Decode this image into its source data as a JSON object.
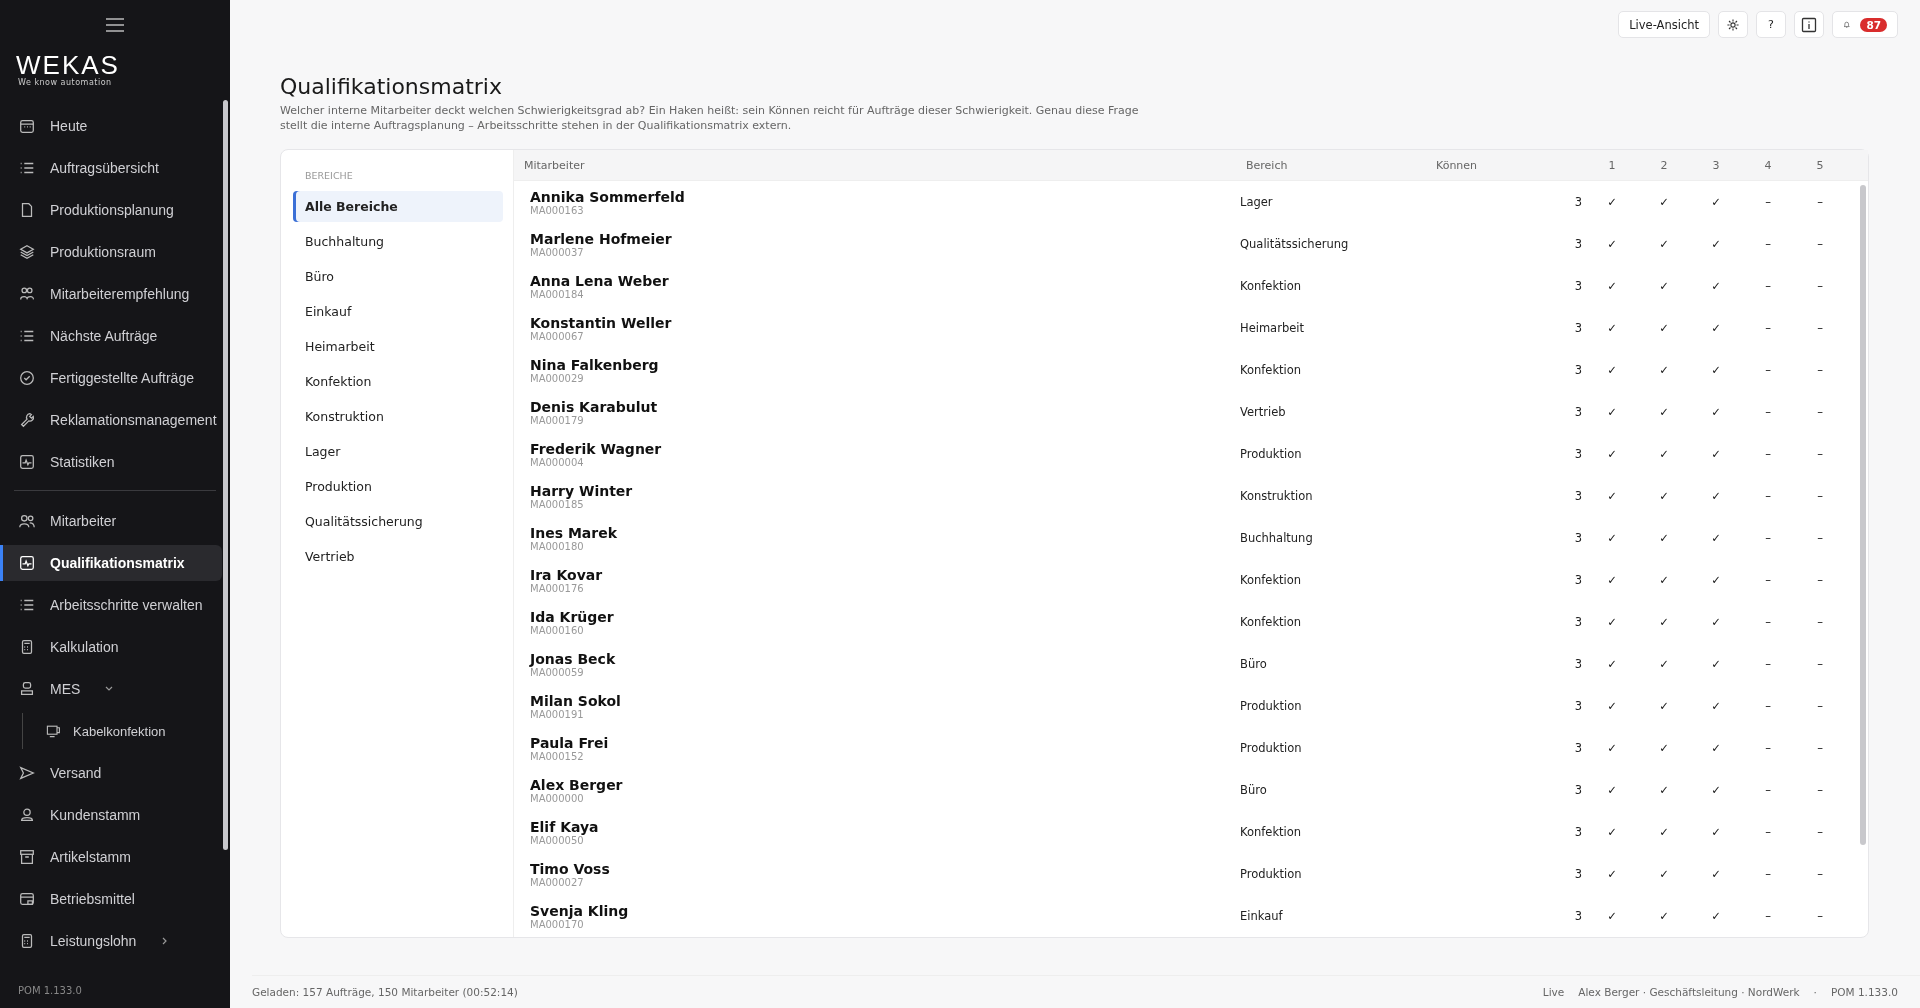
{
  "sidebar": {
    "logo": "WEKAS",
    "tagline": "We know automation",
    "items": [
      {
        "label": "Heute",
        "selected": false
      },
      {
        "label": "Auftragsübersicht",
        "selected": false
      },
      {
        "label": "Produktionsplanung",
        "selected": false
      },
      {
        "label": "Produktionsraum",
        "selected": false
      },
      {
        "label": "Mitarbeiterempfehlung",
        "selected": false
      },
      {
        "label": "Nächste Aufträge",
        "selected": false
      },
      {
        "label": "Fertiggestellte Aufträge",
        "selected": false
      },
      {
        "label": "Reklamationsmanagement",
        "selected": false
      },
      {
        "label": "Statistiken",
        "selected": false,
        "divider_after": true
      },
      {
        "label": "Mitarbeiter",
        "selected": false
      },
      {
        "label": "Qualifikationsmatrix",
        "selected": true
      },
      {
        "label": "Arbeitsschritte verwalten",
        "selected": false
      },
      {
        "label": "Kalkulation",
        "selected": false
      },
      {
        "label": "MES",
        "selected": false,
        "expanded": true,
        "children": [
          {
            "label": "Kabelkonfektion",
            "selected": false
          }
        ]
      },
      {
        "label": "Versand",
        "selected": false
      },
      {
        "label": "Kundenstamm",
        "selected": false
      },
      {
        "label": "Artikelstamm",
        "selected": false
      },
      {
        "label": "Betriebsmittel",
        "selected": false
      },
      {
        "label": "Leistungslohn",
        "selected": false,
        "expanded": false
      }
    ],
    "version": "POM 1.133.0"
  },
  "toolbar": {
    "live_button": "Live-Ansicht",
    "help_button": "?",
    "notification_count": "87"
  },
  "page": {
    "title": "Qualifikationsmatrix",
    "description": "Welcher interne Mitarbeiter deckt welchen Schwierigkeitsgrad ab? Ein Haken heißt: sein Können reicht für Aufträge dieser Schwierigkeit. Genau diese Frage stellt die interne Auftragsplanung – Arbeitsschritte stehen in der Qualifikationsmatrix extern."
  },
  "filters": {
    "heading": "BEREICHE",
    "items": [
      {
        "label": "Alle Bereiche",
        "selected": true
      },
      {
        "label": "Buchhaltung",
        "selected": false
      },
      {
        "label": "Büro",
        "selected": false
      },
      {
        "label": "Einkauf",
        "selected": false
      },
      {
        "label": "Heimarbeit",
        "selected": false
      },
      {
        "label": "Konfektion",
        "selected": false
      },
      {
        "label": "Konstruktion",
        "selected": false
      },
      {
        "label": "Lager",
        "selected": false
      },
      {
        "label": "Produktion",
        "selected": false
      },
      {
        "label": "Qualitätssicherung",
        "selected": false
      },
      {
        "label": "Vertrieb",
        "selected": false
      }
    ]
  },
  "table": {
    "columns": [
      "Mitarbeiter",
      "Bereich",
      "Können",
      "1",
      "2",
      "3",
      "4",
      "5"
    ],
    "rows": [
      {
        "name": "Annika Sommerfeld",
        "id": "MA000163",
        "area": "Lager",
        "skill": "3",
        "levels": [
          "✓",
          "✓",
          "✓",
          "–",
          "–"
        ]
      },
      {
        "name": "Marlene Hofmeier",
        "id": "MA000037",
        "area": "Qualitätssicherung",
        "skill": "3",
        "levels": [
          "✓",
          "✓",
          "✓",
          "–",
          "–"
        ]
      },
      {
        "name": "Anna Lena Weber",
        "id": "MA000184",
        "area": "Konfektion",
        "skill": "3",
        "levels": [
          "✓",
          "✓",
          "✓",
          "–",
          "–"
        ]
      },
      {
        "name": "Konstantin Weller",
        "id": "MA000067",
        "area": "Heimarbeit",
        "skill": "3",
        "levels": [
          "✓",
          "✓",
          "✓",
          "–",
          "–"
        ]
      },
      {
        "name": "Nina Falkenberg",
        "id": "MA000029",
        "area": "Konfektion",
        "skill": "3",
        "levels": [
          "✓",
          "✓",
          "✓",
          "–",
          "–"
        ]
      },
      {
        "name": "Denis Karabulut",
        "id": "MA000179",
        "area": "Vertrieb",
        "skill": "3",
        "levels": [
          "✓",
          "✓",
          "✓",
          "–",
          "–"
        ]
      },
      {
        "name": "Frederik Wagner",
        "id": "MA000004",
        "area": "Produktion",
        "skill": "3",
        "levels": [
          "✓",
          "✓",
          "✓",
          "–",
          "–"
        ]
      },
      {
        "name": "Harry Winter",
        "id": "MA000185",
        "area": "Konstruktion",
        "skill": "3",
        "levels": [
          "✓",
          "✓",
          "✓",
          "–",
          "–"
        ]
      },
      {
        "name": "Ines Marek",
        "id": "MA000180",
        "area": "Buchhaltung",
        "skill": "3",
        "levels": [
          "✓",
          "✓",
          "✓",
          "–",
          "–"
        ]
      },
      {
        "name": "Ira Kovar",
        "id": "MA000176",
        "area": "Konfektion",
        "skill": "3",
        "levels": [
          "✓",
          "✓",
          "✓",
          "–",
          "–"
        ]
      },
      {
        "name": "Ida Krüger",
        "id": "MA000160",
        "area": "Konfektion",
        "skill": "3",
        "levels": [
          "✓",
          "✓",
          "✓",
          "–",
          "–"
        ]
      },
      {
        "name": "Jonas Beck",
        "id": "MA000059",
        "area": "Büro",
        "skill": "3",
        "levels": [
          "✓",
          "✓",
          "✓",
          "–",
          "–"
        ]
      },
      {
        "name": "Milan Sokol",
        "id": "MA000191",
        "area": "Produktion",
        "skill": "3",
        "levels": [
          "✓",
          "✓",
          "✓",
          "–",
          "–"
        ]
      },
      {
        "name": "Paula Frei",
        "id": "MA000152",
        "area": "Produktion",
        "skill": "3",
        "levels": [
          "✓",
          "✓",
          "✓",
          "–",
          "–"
        ]
      },
      {
        "name": "Alex Berger",
        "id": "MA000000",
        "area": "Büro",
        "skill": "3",
        "levels": [
          "✓",
          "✓",
          "✓",
          "–",
          "–"
        ]
      },
      {
        "name": "Elif Kaya",
        "id": "MA000050",
        "area": "Konfektion",
        "skill": "3",
        "levels": [
          "✓",
          "✓",
          "✓",
          "–",
          "–"
        ]
      },
      {
        "name": "Timo Voss",
        "id": "MA000027",
        "area": "Produktion",
        "skill": "3",
        "levels": [
          "✓",
          "✓",
          "✓",
          "–",
          "–"
        ]
      },
      {
        "name": "Svenja Kling",
        "id": "MA000170",
        "area": "Einkauf",
        "skill": "3",
        "levels": [
          "✓",
          "✓",
          "✓",
          "–",
          "–"
        ]
      }
    ]
  },
  "status_bar": {
    "left": "Geladen: 157 Aufträge, 150 Mitarbeiter (00:52:14)",
    "mode": "Live",
    "user": "Alex Berger · Geschäftsleitung · NordWerk",
    "separator": "·",
    "version": "POM 1.133.0"
  }
}
